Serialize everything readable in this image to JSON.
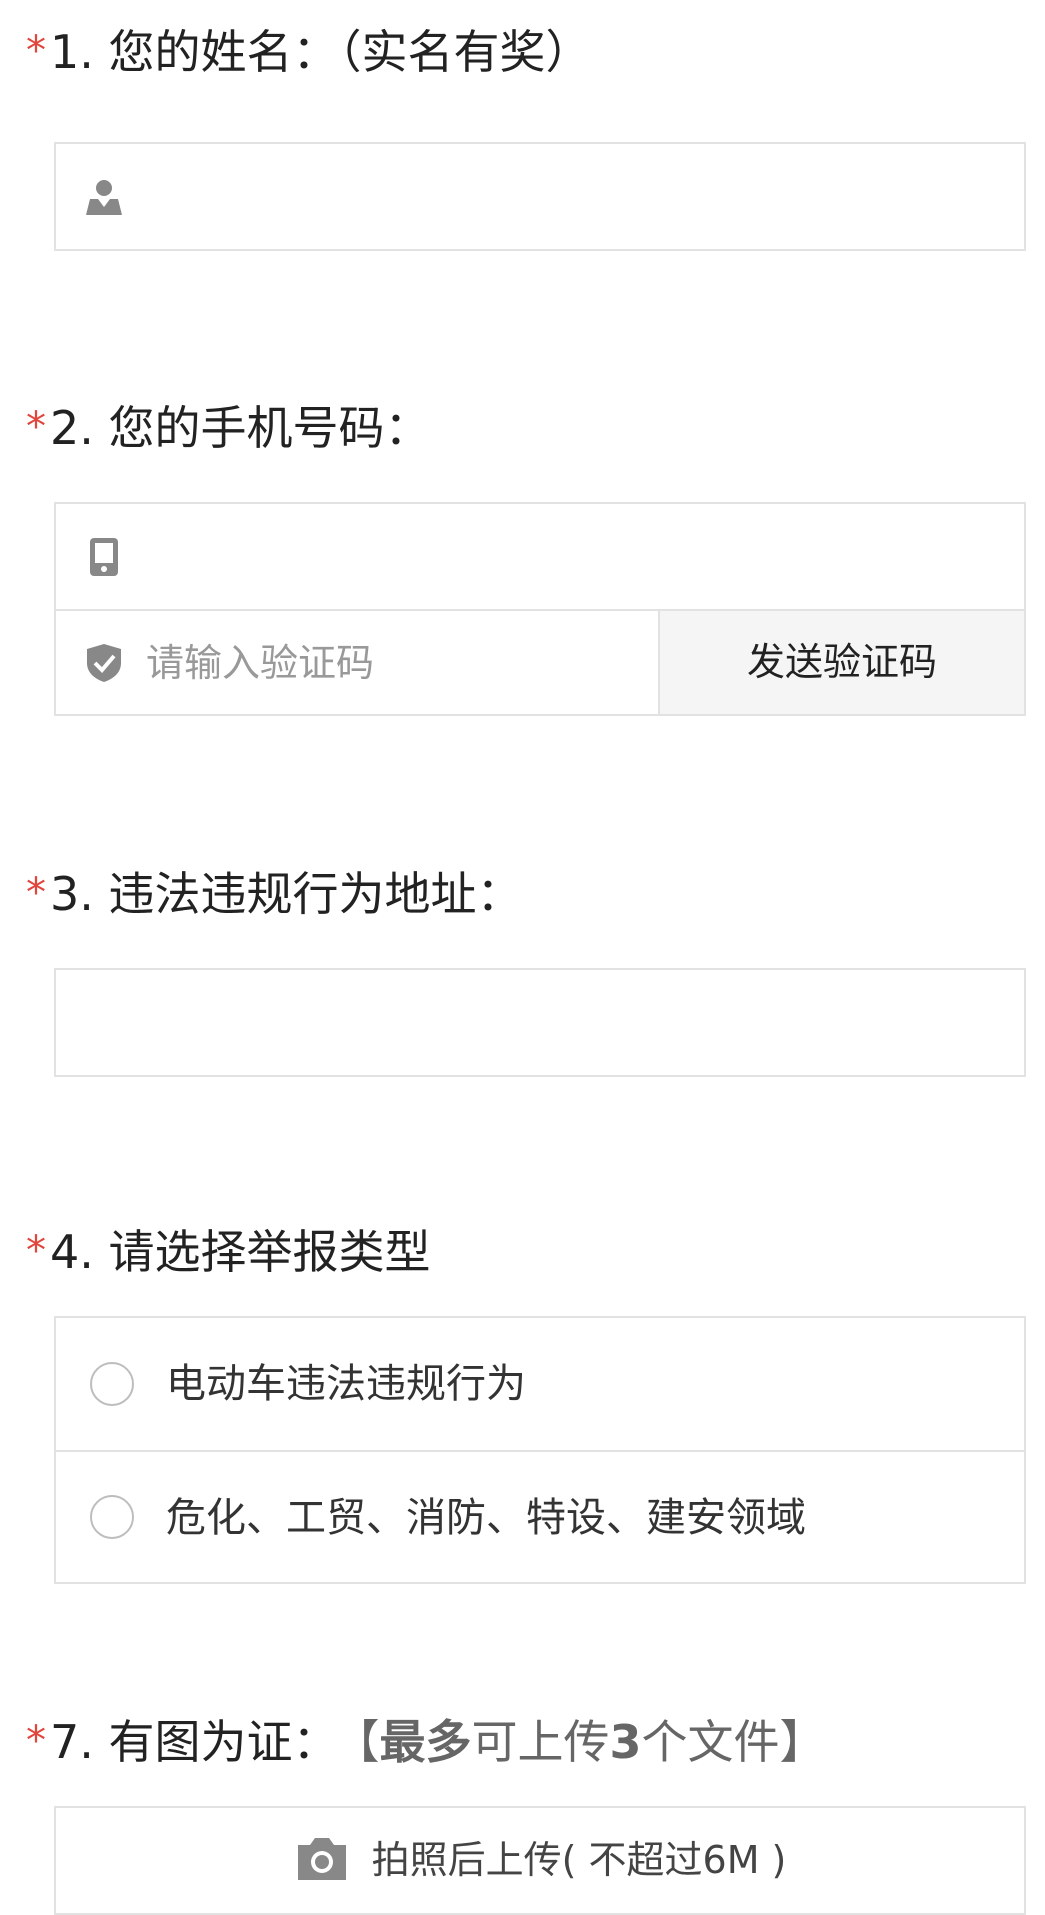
{
  "q1": {
    "marker": "*",
    "title": "1. 您的姓名：（实名有奖）",
    "name_value": ""
  },
  "q2": {
    "marker": "*",
    "title": "2. 您的手机号码：",
    "phone_value": "",
    "code_placeholder": "请输入验证码",
    "send_code_label": "发送验证码"
  },
  "q3": {
    "marker": "*",
    "title": "3. 违法违规行为地址：",
    "address_value": ""
  },
  "q4": {
    "marker": "*",
    "title": "4. 请选择举报类型",
    "options": [
      "电动车违法违规行为",
      "危化、工贸、消防、特设、建安领域"
    ]
  },
  "q7": {
    "marker": "*",
    "title": "7. 有图为证：",
    "note_open": "【",
    "note_bold1": "最多",
    "note_mid": "可上传",
    "note_bold2": "3",
    "note_end": "个文件】",
    "upload_label": "拍照后上传( 不超过6M )"
  },
  "colors": {
    "required_marker": "#e0463c",
    "border": "#e2e2e2",
    "icon": "#888888",
    "button_bg": "#f5f5f5"
  },
  "icons": {
    "name": "person-icon",
    "phone": "phone-icon",
    "code": "shield-check-icon",
    "upload": "camera-icon"
  }
}
